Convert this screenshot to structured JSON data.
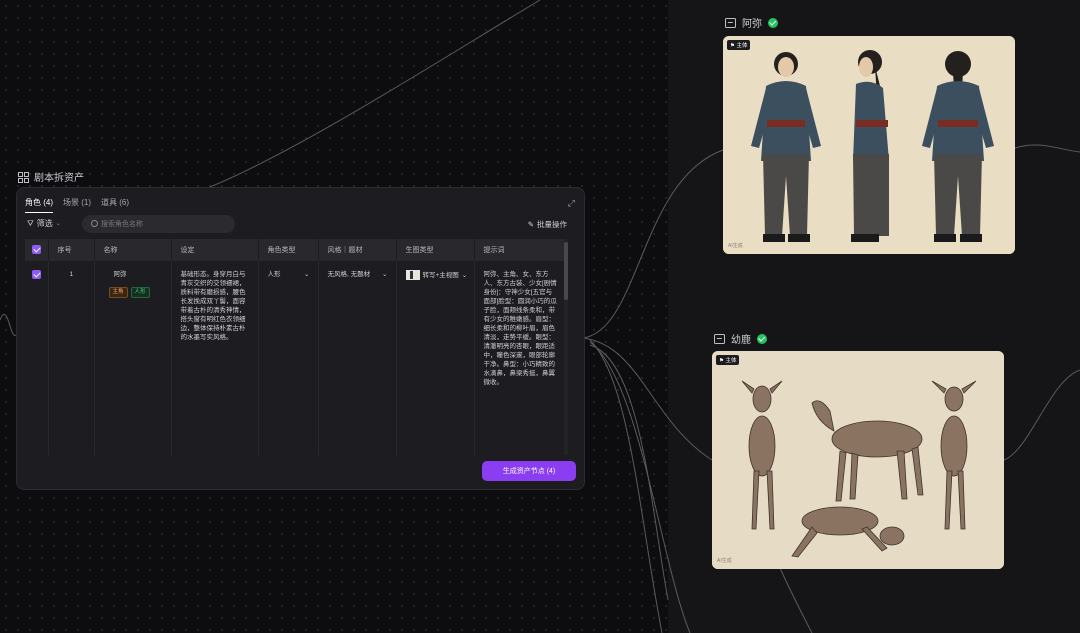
{
  "panel": {
    "title": "剧本拆资产",
    "tabs": [
      {
        "label": "角色 (4)",
        "active": true
      },
      {
        "label": "场景 (1)",
        "active": false
      },
      {
        "label": "道具 (6)",
        "active": false
      }
    ],
    "filter_label": "筛选",
    "search_placeholder": "搜索角色名称",
    "bulk_label": "批量操作",
    "generate_button": "生成资产节点 (4)"
  },
  "table": {
    "headers": [
      "序号",
      "名称",
      "设定",
      "角色类型",
      "风格｜题材",
      "生图类型",
      "提示词"
    ],
    "rows": [
      {
        "index": "1",
        "name": "阿弥",
        "badges": [
          "主角",
          "人形"
        ],
        "setting": "基础形态。身穿月白与青灰交织的交领襦裙，质料带有磨损感，腰色长发挽成双丫髻，面容带着古朴的清秀神情，搭头窗有明红色衣领细边，整体保持朴素古朴的水墨写实风格。",
        "role_type": "人形",
        "style": "无风格, 无题材",
        "gen_type": "转写+主视图",
        "prompt": "阿弥、主角、女、东方人、东方古装、少女[剧情身份]：守神少女[五官与面部]脸型：圆润小巧的瓜子脸，面颊线条柔和，带有少女的稚嫩感。眉型：细长柔和的柳叶眉，眉色清淡，走势平缓。眼型：清澈明亮的杏眼，眼距适中，瞳色深邃，眼部轮廓干净。鼻型：小巧精致的水滴鼻，鼻梁秀挺，鼻翼微收。"
      }
    ]
  },
  "nodes": [
    {
      "title": "阿弥",
      "tag": "主体",
      "watermark": "AI生成",
      "status": "done"
    },
    {
      "title": "幼鹿",
      "tag": "主体",
      "watermark": "AI生成",
      "status": "done"
    }
  ],
  "colors": {
    "accent": "#8b3df2",
    "success": "#22c55e",
    "badge_main": "#f0a35a",
    "badge_human": "#57c98a"
  }
}
